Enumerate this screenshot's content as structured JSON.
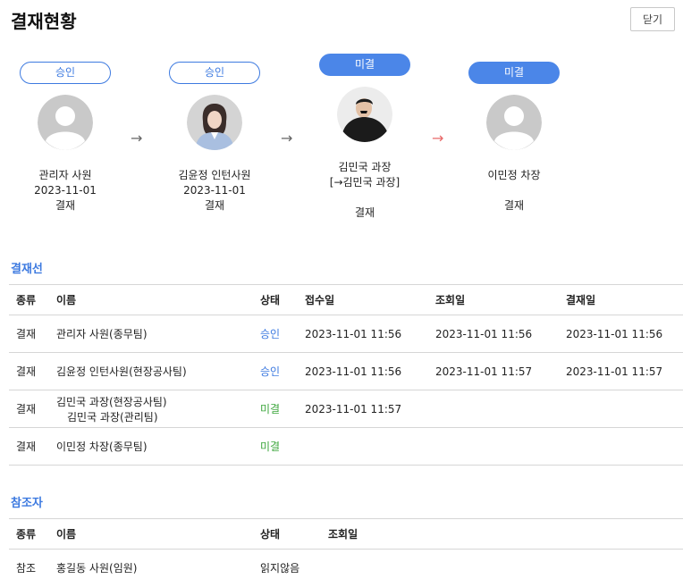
{
  "header": {
    "title": "결재현황",
    "close_label": "닫기"
  },
  "flow": {
    "approvers": [
      {
        "status": "승인",
        "name": "관리자 사원",
        "date": "2023-11-01",
        "type": "결재"
      },
      {
        "status": "승인",
        "name": "김윤정 인턴사원",
        "date": "2023-11-01",
        "type": "결재"
      },
      {
        "status": "미결",
        "name": "김민국 과장",
        "delegate": "[→김민국 과장]",
        "type": "결재"
      },
      {
        "status": "미결",
        "name": "이민정 차장",
        "type": "결재"
      }
    ]
  },
  "approval_line": {
    "title": "결재선",
    "headers": {
      "type": "종류",
      "name": "이름",
      "status": "상태",
      "received": "접수일",
      "viewed": "조회일",
      "approved": "결재일"
    },
    "rows": [
      {
        "type": "결재",
        "name": "관리자 사원(종무팀)",
        "status": "승인",
        "received": "2023-11-01 11:56",
        "viewed": "2023-11-01 11:56",
        "approved": "2023-11-01 11:56"
      },
      {
        "type": "결재",
        "name": "김윤정 인턴사원(현장공사팀)",
        "status": "승인",
        "received": "2023-11-01 11:56",
        "viewed": "2023-11-01 11:57",
        "approved": "2023-11-01 11:57"
      },
      {
        "type": "결재",
        "name": "김민국 과장(현장공사팀)",
        "name_sub": "김민국 과장(관리팀)",
        "status": "미결",
        "received": "2023-11-01 11:57",
        "viewed": "",
        "approved": ""
      },
      {
        "type": "결재",
        "name": "이민정 차장(종무팀)",
        "status": "미결",
        "received": "",
        "viewed": "",
        "approved": ""
      }
    ]
  },
  "references": {
    "title": "참조자",
    "headers": {
      "type": "종류",
      "name": "이름",
      "status": "상태",
      "viewed": "조회일"
    },
    "rows": [
      {
        "type": "참조",
        "name": "홍길동 사원(임원)",
        "status": "읽지않음",
        "viewed": ""
      }
    ]
  },
  "colors": {
    "accent": "#3d7ae0",
    "pending_badge": "#4b86e8",
    "pending_text": "#3aa53a",
    "next_arrow": "#e86a6a"
  }
}
